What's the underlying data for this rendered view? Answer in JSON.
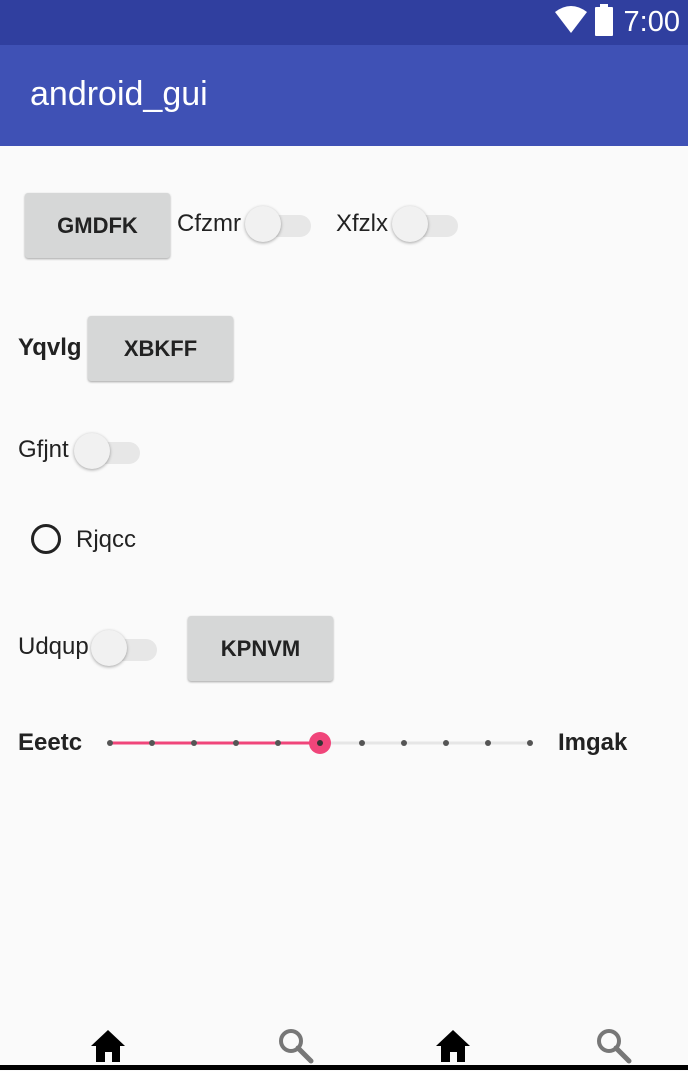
{
  "status_bar": {
    "time": "7:00",
    "icons": [
      "wifi-icon",
      "battery-icon"
    ]
  },
  "app_bar": {
    "title": "android_gui"
  },
  "row1": {
    "button_label": "GMDFK",
    "switch1_label": "Cfzmr",
    "switch1_on": false,
    "switch2_label": "Xfzlx",
    "switch2_on": false
  },
  "row2": {
    "label": "Yqvlg",
    "button_label": "XBKFF"
  },
  "row3": {
    "switch_label": "Gfjnt",
    "switch_on": false
  },
  "row4": {
    "radio_label": "Rjqcc",
    "radio_checked": false
  },
  "row5": {
    "switch_label": "Udqup",
    "switch_on": false,
    "button_label": "KPNVM"
  },
  "row6": {
    "left_label": "Eeetc",
    "right_label": "Imgak",
    "seekbar": {
      "min": 0,
      "max": 10,
      "value": 5,
      "accent": "#f0457a"
    }
  },
  "bottom_nav": {
    "items": [
      "home-icon",
      "search-icon",
      "home-icon",
      "search-icon"
    ]
  },
  "colors": {
    "status_bar": "#303f9f",
    "app_bar": "#3f51b5",
    "background": "#fafafa"
  }
}
